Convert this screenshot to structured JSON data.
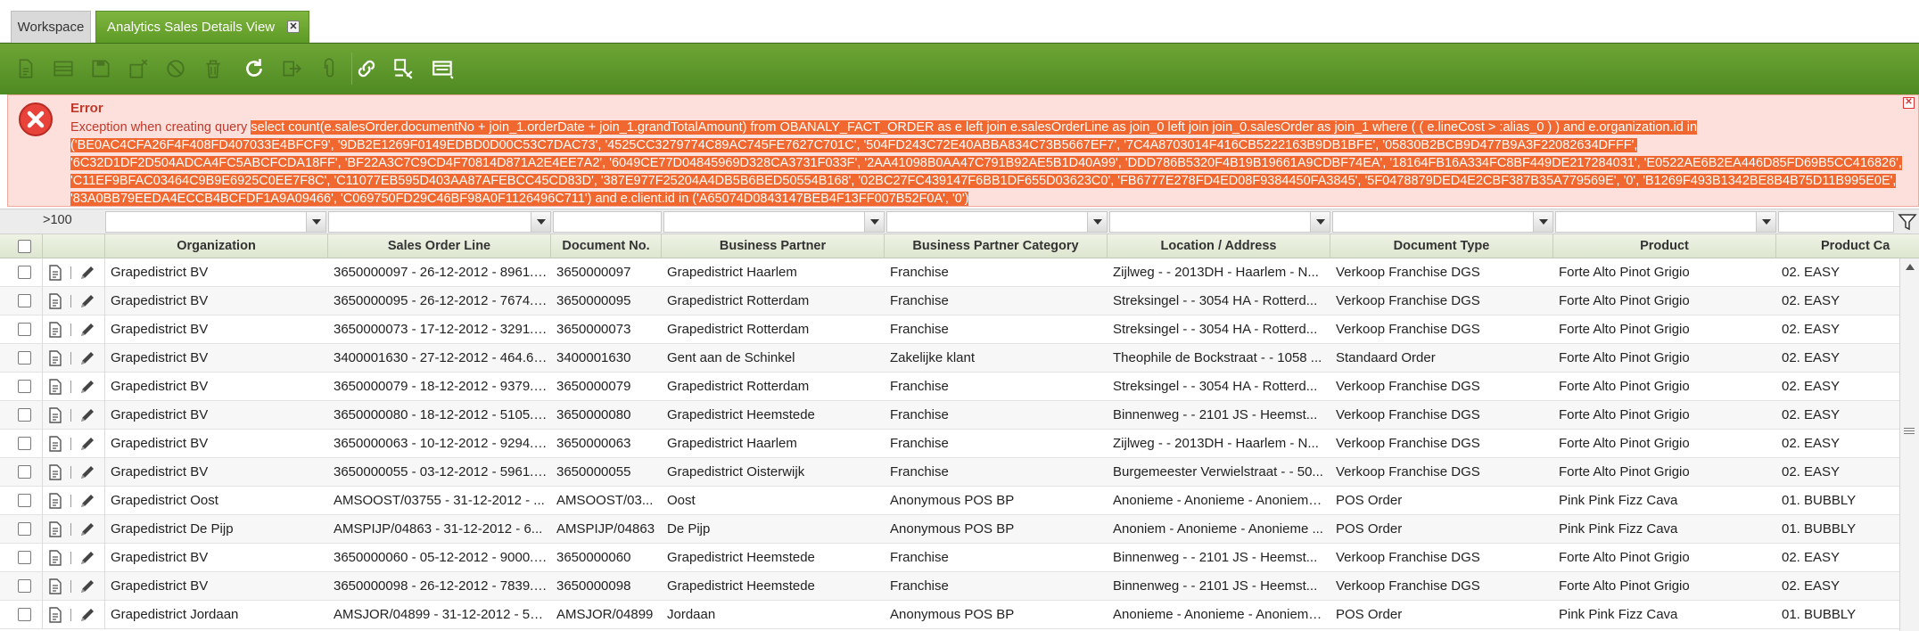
{
  "tabs": {
    "workspace": "Workspace",
    "analytics": "Analytics Sales Details View",
    "close_glyph": "✕"
  },
  "toolbar": {
    "buttons": [
      {
        "name": "new-document-icon",
        "enabled": false
      },
      {
        "name": "grid-view-icon",
        "enabled": false
      },
      {
        "name": "save-icon",
        "enabled": false
      },
      {
        "name": "delete-new-icon",
        "enabled": false
      },
      {
        "name": "undo-icon",
        "enabled": false
      },
      {
        "name": "trash-icon",
        "enabled": false
      },
      {
        "name": "refresh-icon",
        "enabled": true
      },
      {
        "name": "export-icon",
        "enabled": false
      },
      {
        "name": "attachment-icon",
        "enabled": false
      },
      {
        "name": "link-icon",
        "enabled": true
      },
      {
        "name": "customize-tools-icon",
        "enabled": true
      },
      {
        "name": "window-layout-icon",
        "enabled": true
      }
    ]
  },
  "error": {
    "title": "Error",
    "prefix": "Exception when creating query ",
    "query": "select count(e.salesOrder.documentNo + join_1.orderDate + join_1.grandTotalAmount) from OBANALY_FACT_ORDER as e left join e.salesOrderLine as join_0 left join join_0.salesOrder as join_1 where ( ( e.lineCost > :alias_0 ) ) and e.organization.id in ('BE0AC4CFA26F4F408FD407033E4BFCF9', '9DB2E1269F0149EDBD0D00C53C7DAC73', '4525CC3279774C89AC745FE7627C701C', '504FD243C72E40ABBA834C73B5667EF7', '7C4A8703014F416CB5222163B9DB1BFE', '05830B2BCB9D477B9A3F22082634DFFF', '6C32D1DF2D504ADCA4FC5ABCFCDA18FF', 'BF22A3C7C9CD4F70814D871A2E4EE7A2', '6049CE77D04845969D328CA3731F033F', '2AA41098B0AA47C791B92AE5B1D40A99', 'DDD786B5320F4B19B19661A9CDBF74EA', '18164FB16A334FC8BF449DE217284031', 'E0522AE6B2EA446D85FD69B5CC416826', 'C11EF9BFAC03464C9B9E6925C0EE7F8C', 'C11077EB595D403AA87AFEBCC45CD83D', '387E977F25204A4DB5B6BED50554B168', '02BC27FC439147F6BB1DF655D03623C0', 'FB6777E278FD4ED08F9384450FA3845', '5F0478879DED4E2CBF387B35A779569E', '0', 'B1269F493B1342BE8B4B75D11B995E0E', '83A0BB79EEDA4ECCB4BCFDF1A9A09466', 'C069750FD29C46BF98A0F1126496C711') and e.client.id in ('A65074D0843147BEB4F13FF007B52F0A', '0')",
    "close_glyph": "✕"
  },
  "grid": {
    "filter_count": ">100",
    "columns": [
      {
        "key": "organization",
        "label": "Organization"
      },
      {
        "key": "sales_order_line",
        "label": "Sales Order Line"
      },
      {
        "key": "document_no",
        "label": "Document No."
      },
      {
        "key": "business_partner",
        "label": "Business Partner"
      },
      {
        "key": "bp_category",
        "label": "Business Partner Category"
      },
      {
        "key": "location",
        "label": "Location / Address"
      },
      {
        "key": "document_type",
        "label": "Document Type"
      },
      {
        "key": "product",
        "label": "Product"
      },
      {
        "key": "product_category",
        "label": "Product Ca"
      }
    ],
    "rows": [
      [
        "Grapedistrict BV",
        "3650000097 - 26-12-2012 - 8961.0...",
        "3650000097",
        "Grapedistrict Haarlem",
        "Franchise",
        "Zijlweg -  - 2013DH - Haarlem - N...",
        "Verkoop Franchise DGS",
        "Forte Alto Pinot Grigio",
        "02. EASY"
      ],
      [
        "Grapedistrict BV",
        "3650000095 - 26-12-2012 - 7674.6...",
        "3650000095",
        "Grapedistrict Rotterdam",
        "Franchise",
        "Streksingel -  - 3054 HA - Rotterd...",
        "Verkoop Franchise DGS",
        "Forte Alto Pinot Grigio",
        "02. EASY"
      ],
      [
        "Grapedistrict BV",
        "3650000073 - 17-12-2012 - 3291.0...",
        "3650000073",
        "Grapedistrict Rotterdam",
        "Franchise",
        "Streksingel -  - 3054 HA - Rotterd...",
        "Verkoop Franchise DGS",
        "Forte Alto Pinot Grigio",
        "02. EASY"
      ],
      [
        "Grapedistrict BV",
        "3400001630 - 27-12-2012 - 464.64...",
        "3400001630",
        "Gent aan de Schinkel",
        "Zakelijke klant",
        "Theophile de Bockstraat  -  - 1058 ...",
        "Standaard Order",
        "Forte Alto Pinot Grigio",
        "02. EASY"
      ],
      [
        "Grapedistrict BV",
        "3650000079 - 18-12-2012 - 9379.5...",
        "3650000079",
        "Grapedistrict Rotterdam",
        "Franchise",
        "Streksingel -  - 3054 HA - Rotterd...",
        "Verkoop Franchise DGS",
        "Forte Alto Pinot Grigio",
        "02. EASY"
      ],
      [
        "Grapedistrict BV",
        "3650000080 - 18-12-2012 - 5105.0...",
        "3650000080",
        "Grapedistrict Heemstede",
        "Franchise",
        "Binnenweg -  - 2101 JS - Heemst...",
        "Verkoop Franchise DGS",
        "Forte Alto Pinot Grigio",
        "02. EASY"
      ],
      [
        "Grapedistrict BV",
        "3650000063 - 10-12-2012 - 9294.9...",
        "3650000063",
        "Grapedistrict Haarlem",
        "Franchise",
        "Zijlweg -  - 2013DH - Haarlem - N...",
        "Verkoop Franchise DGS",
        "Forte Alto Pinot Grigio",
        "02. EASY"
      ],
      [
        "Grapedistrict BV",
        "3650000055 - 03-12-2012 - 5961.5...",
        "3650000055",
        "Grapedistrict Oisterwijk",
        "Franchise",
        "Burgemeester Verwielstraat -  - 50...",
        "Verkoop Franchise DGS",
        "Forte Alto Pinot Grigio",
        "02. EASY"
      ],
      [
        "Grapedistrict Oost",
        "AMSOOST/03755 - 31-12-2012 - ...",
        "AMSOOST/03...",
        "Oost",
        "Anonymous POS BP",
        "Anonieme - Anonieme - Anonieme...",
        "POS Order",
        "Pink Pink Fizz Cava",
        "01. BUBBLY"
      ],
      [
        "Grapedistrict De Pijp",
        "AMSPIJP/04863 - 31-12-2012 - 6...",
        "AMSPIJP/04863",
        "De Pijp",
        "Anonymous POS BP",
        "Anoniem - Anonieme - Anonieme ...",
        "POS Order",
        "Pink Pink Fizz Cava",
        "01. BUBBLY"
      ],
      [
        "Grapedistrict BV",
        "3650000060 - 05-12-2012 - 9000.9...",
        "3650000060",
        "Grapedistrict Heemstede",
        "Franchise",
        "Binnenweg -  - 2101 JS - Heemst...",
        "Verkoop Franchise DGS",
        "Forte Alto Pinot Grigio",
        "02. EASY"
      ],
      [
        "Grapedistrict BV",
        "3650000098 - 26-12-2012 - 7839.1...",
        "3650000098",
        "Grapedistrict Heemstede",
        "Franchise",
        "Binnenweg -  - 2101 JS - Heemst...",
        "Verkoop Franchise DGS",
        "Forte Alto Pinot Grigio",
        "02. EASY"
      ],
      [
        "Grapedistrict Jordaan",
        "AMSJOR/04899 - 31-12-2012 - 51...",
        "AMSJOR/04899",
        "Jordaan",
        "Anonymous POS BP",
        "Anonieme - Anonieme - Anonieme...",
        "POS Order",
        "Pink Pink Fizz Cava",
        "01. BUBBLY"
      ]
    ]
  },
  "colors": {
    "toolbar_green": "#5d9a26",
    "error_bg": "#fde0dc",
    "error_text": "#c0392b",
    "selection": "#f06830"
  }
}
